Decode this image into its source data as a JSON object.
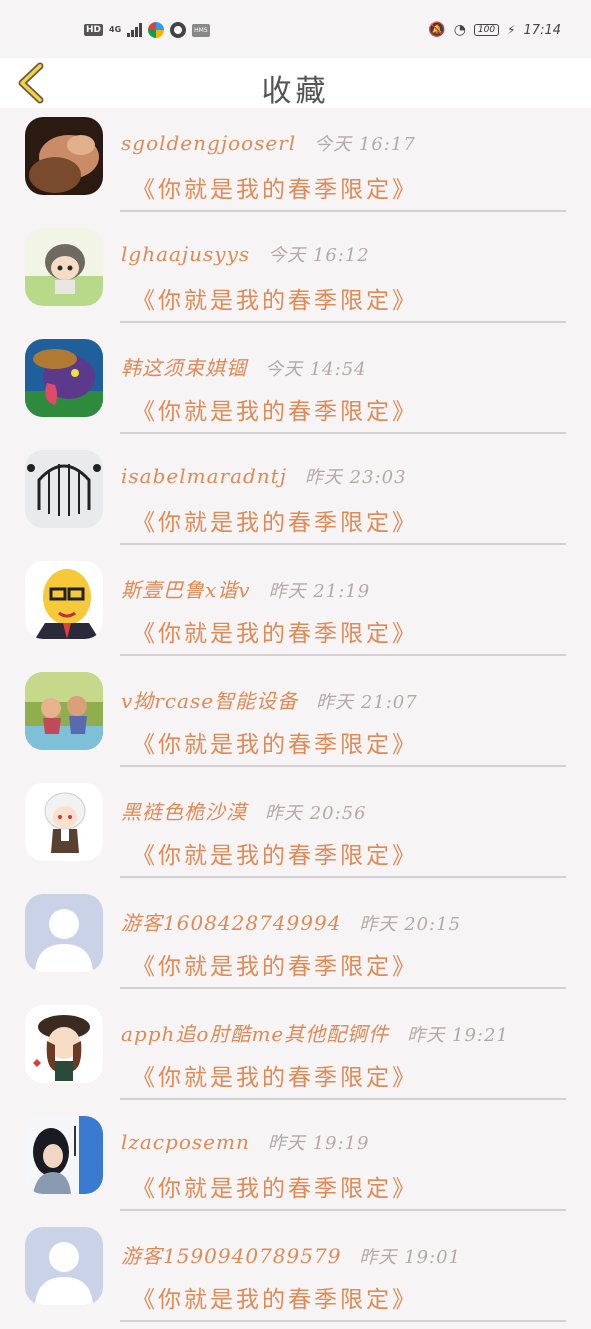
{
  "status_bar": {
    "hd": "HD",
    "network": "4G",
    "sms": "HMS",
    "battery": "100",
    "time": "17:14"
  },
  "header": {
    "title": "收藏"
  },
  "favorites": [
    {
      "name": "sgoldengjooserl",
      "time": "今天 16:17",
      "message": "《你就是我的春季限定》",
      "avatar": "woman-photo"
    },
    {
      "name": "lghaajusyys",
      "time": "今天 16:12",
      "message": "《你就是我的春季限定》",
      "avatar": "anime-boy-grass"
    },
    {
      "name": "韩这须束娸锢",
      "time": "今天 14:54",
      "message": "《你就是我的春季限定》",
      "avatar": "purple-monster"
    },
    {
      "name": "isabelmaradntj",
      "time": "昨天 23:03",
      "message": "《你就是我的春季限定》",
      "avatar": "iron-gate"
    },
    {
      "name": "斯壹巴鲁x谐v",
      "time": "昨天 21:19",
      "message": "《你就是我的春季限定》",
      "avatar": "cartoon-man-glasses"
    },
    {
      "name": "v拗rcase智能设备",
      "time": "昨天 21:07",
      "message": "《你就是我的春季限定》",
      "avatar": "couple-picnic"
    },
    {
      "name": "黑裢色桅沙漠",
      "time": "昨天 20:56",
      "message": "《你就是我的春季限定》",
      "avatar": "white-hair-chibi"
    },
    {
      "name": "游客1608428749994",
      "time": "昨天 20:15",
      "message": "《你就是我的春季限定》",
      "avatar": "default-user"
    },
    {
      "name": "apph追o肘酷me其他配锕件",
      "time": "昨天 19:21",
      "message": "《你就是我的春季限定》",
      "avatar": "girl-hat-cartoon"
    },
    {
      "name": "lzacposemn",
      "time": "昨天 19:19",
      "message": "《你就是我的春季限定》",
      "avatar": "girl-poster"
    },
    {
      "name": "游客1590940789579",
      "time": "昨天 19:01",
      "message": "《你就是我的春季限定》",
      "avatar": "default-user"
    }
  ]
}
